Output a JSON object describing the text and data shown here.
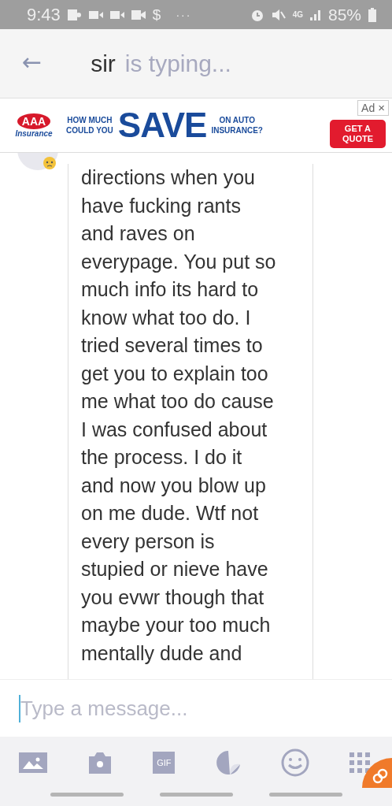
{
  "status_bar": {
    "time": "9:43",
    "notification_dollar": "$",
    "more": "···",
    "battery": "85%",
    "network": "4G"
  },
  "header": {
    "back": "←",
    "name": "sir",
    "status": "is typing..."
  },
  "ad": {
    "logo": "AAA",
    "logo_sub": "Insurance",
    "line_1": "HOW MUCH\nCOULD YOU",
    "headline": "SAVE",
    "line_2": "ON AUTO\nINSURANCE?",
    "button": "GET A\nQUOTE",
    "badge": "Ad",
    "close": "×"
  },
  "messages": [
    {
      "text": "directions when you\nhave fucking rants\nand raves on\neverypage. You put so\nmuch info its hard to\nknow what too do. I\ntried several times to\nget you to explain too\nme what too do cause\nI was confused about\nthe process. I do it\nand now you blow up\non me dude. Wtf not\nevery person is\nstupied or nieve have\nyou evwr though that\nmaybe your too much\nmentally dude and"
    }
  ],
  "composer": {
    "placeholder": "Type a message..."
  },
  "toolbar": {
    "gif": "GIF"
  }
}
